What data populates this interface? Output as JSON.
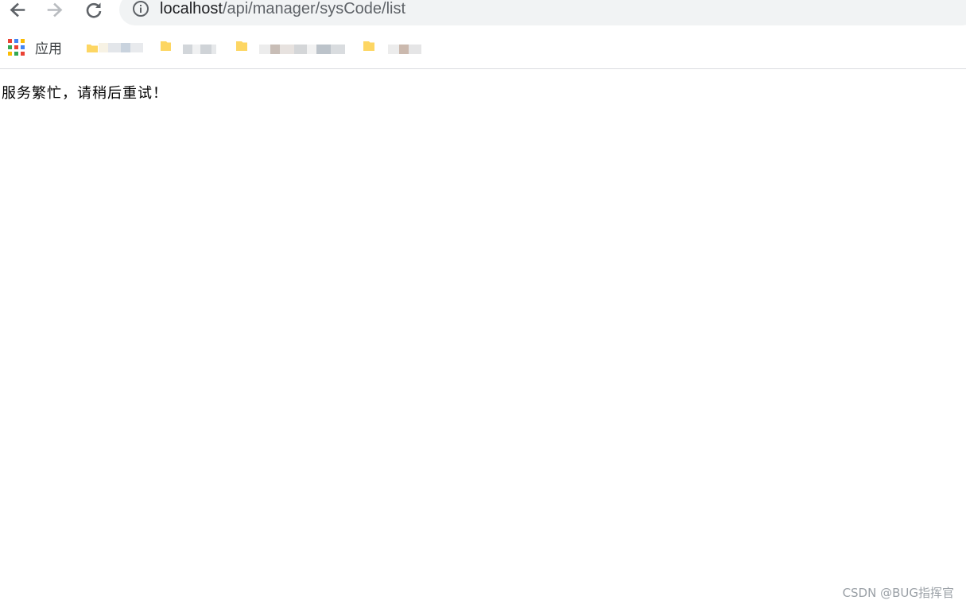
{
  "browser": {
    "address_bar": {
      "host": "localhost",
      "path": "/api/manager/sysCode/list"
    },
    "bookmarks_bar": {
      "apps_label": "应用",
      "apps_icon": "apps-grid-icon",
      "items": [
        {
          "icon": "folder-icon"
        },
        {
          "icon": "folder-icon"
        },
        {
          "icon": "folder-icon"
        },
        {
          "icon": "folder-icon"
        }
      ]
    }
  },
  "page": {
    "message": "服务繁忙，请稍后重试！"
  },
  "watermark": {
    "text": "CSDN @BUG指挥官"
  },
  "colors": {
    "omnibox_bg": "#f1f3f4",
    "folder_yellow": "#fdd663",
    "divider": "#dadce0"
  }
}
